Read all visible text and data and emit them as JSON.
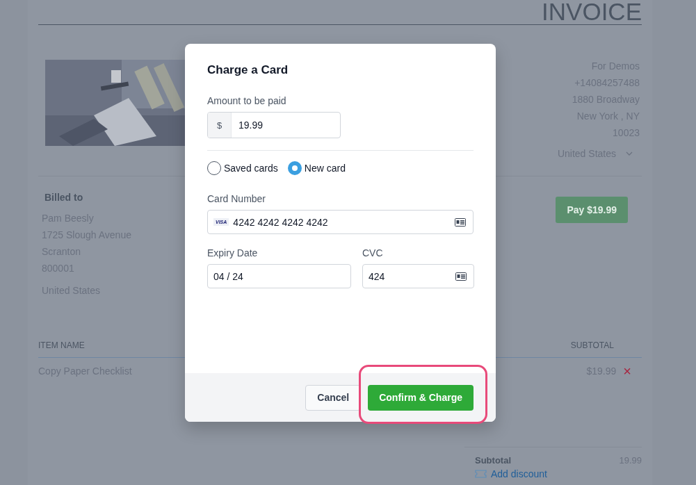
{
  "invoice": {
    "title": "INVOICE",
    "sender": [
      "For Demos",
      "+14084257488",
      "1880 Broadway",
      "New York , NY",
      "10023"
    ],
    "sender_country": "United States",
    "billed_to": {
      "heading": "Billed to",
      "lines": [
        "Pam Beesly",
        "1725 Slough Avenue",
        "Scranton",
        "800001"
      ],
      "country": "United States"
    },
    "pay_button": "Pay $19.99",
    "table": {
      "columns": [
        "ITEM NAME",
        "SUBTOTAL"
      ],
      "rows": [
        {
          "item": "Copy Paper Checklist",
          "subtotal": "$19.99",
          "remove": "×"
        }
      ]
    },
    "totals": {
      "label": "Subtotal",
      "value": "19.99",
      "discount_link": "Add discount"
    }
  },
  "modal": {
    "title": "Charge a Card",
    "amount": {
      "label": "Amount to be paid",
      "prefix": "$",
      "value": "19.99"
    },
    "card_choice": [
      {
        "label": "Saved cards",
        "selected": false
      },
      {
        "label": "New card",
        "selected": true
      }
    ],
    "card_number": {
      "label": "Card Number",
      "brand": "VISA",
      "value": "4242 4242 4242 4242"
    },
    "expiry": {
      "label": "Expiry Date",
      "value": "04 / 24"
    },
    "cvc": {
      "label": "CVC",
      "value": "424"
    },
    "buttons": [
      {
        "label": "Cancel",
        "kind": "secondary"
      },
      {
        "label": "Confirm & Charge",
        "kind": "primary",
        "highlighted": true
      }
    ]
  }
}
